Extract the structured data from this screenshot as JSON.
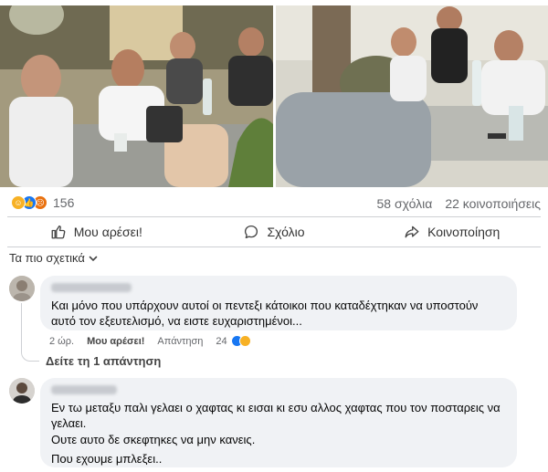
{
  "post": {
    "reaction_icons": [
      "haha-reaction-icon",
      "like-reaction-icon",
      "angry-reaction-icon"
    ],
    "reaction_count": "156",
    "comments_count": "58 σχόλια",
    "shares_count": "22 κοινοποιήσεις"
  },
  "actions": {
    "like": "Μου αρέσει!",
    "comment": "Σχόλιο",
    "share": "Κοινοποίηση"
  },
  "sort": {
    "label": "Τα πιο σχετικά"
  },
  "comments": [
    {
      "text": "Και μόνο που υπάρχουν αυτοί οι πεντεξι κάτοικοι που καταδέχτηκαν να υποστούν αυτό τον εξευτελισμό, να ειστε ευχαριστημένοι...",
      "time": "2 ώρ.",
      "like_label": "Μου αρέσει!",
      "reply_label": "Απάντηση",
      "reaction_count": "24",
      "view_replies": "Δείτε τη 1 απάντηση"
    },
    {
      "lines": [
        "Εν τω μεταξυ παλι γελαει ο χαφτας κι εισαι κι εσυ αλλος χαφτας που τον ποσταρεις να γελαει.",
        "Ουτε αυτο δε σκεφτηκες να μην κανεις.",
        "Που εχουμε μπλεξει.."
      ]
    }
  ],
  "colors": {
    "accent": "#1877f2",
    "bubble": "#f0f2f5",
    "muted_text": "#65676b"
  }
}
